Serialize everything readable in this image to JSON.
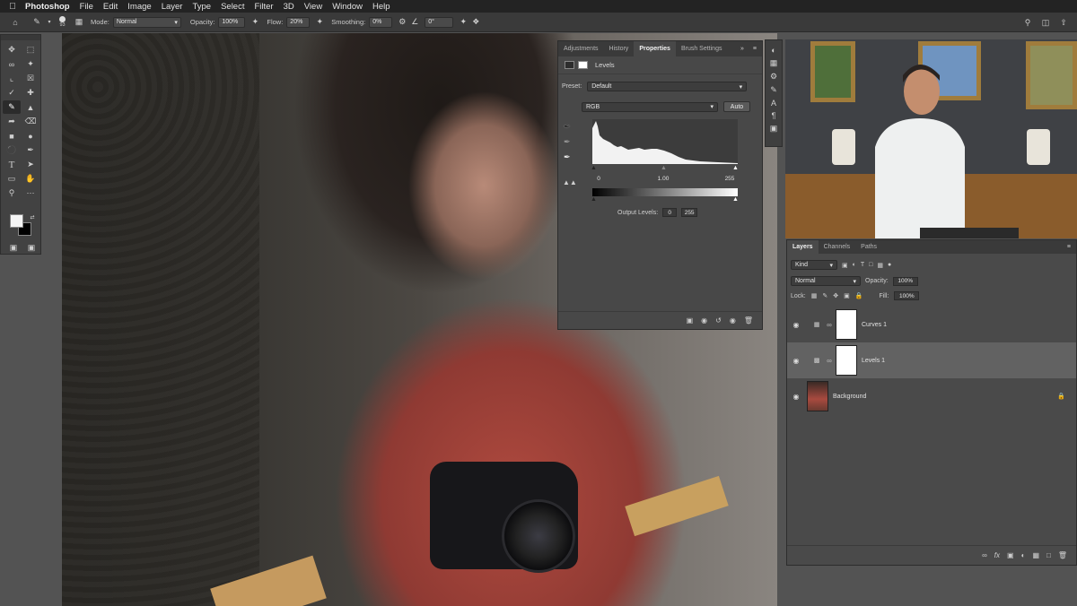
{
  "menubar": {
    "app_name": "Photoshop",
    "items": [
      "File",
      "Edit",
      "Image",
      "Layer",
      "Type",
      "Select",
      "Filter",
      "3D",
      "View",
      "Window",
      "Help"
    ]
  },
  "options_bar": {
    "brush_size": "93",
    "mode_label": "Mode:",
    "mode_value": "Normal",
    "opacity_label": "Opacity:",
    "opacity_value": "100%",
    "flow_label": "Flow:",
    "flow_value": "20%",
    "smoothing_label": "Smoothing:",
    "smoothing_value": "0%",
    "angle_value": "0°"
  },
  "properties": {
    "tabs": [
      "Adjustments",
      "History",
      "Properties",
      "Brush Settings"
    ],
    "active_tab": "Properties",
    "title": "Levels",
    "preset_label": "Preset:",
    "preset_value": "Default",
    "channel_value": "RGB",
    "auto_label": "Auto",
    "input_black": "0",
    "input_mid": "1.00",
    "input_white": "255",
    "output_label": "Output Levels:",
    "output_black": "0",
    "output_white": "255"
  },
  "layers": {
    "tabs": [
      "Layers",
      "Channels",
      "Paths"
    ],
    "active_tab": "Layers",
    "filter_value": "Kind",
    "blend_value": "Normal",
    "opacity_label": "Opacity:",
    "opacity_value": "100%",
    "lock_label": "Lock:",
    "fill_label": "Fill:",
    "fill_value": "100%",
    "items": [
      {
        "name": "Curves 1",
        "selected": false
      },
      {
        "name": "Levels 1",
        "selected": true
      },
      {
        "name": "Background",
        "selected": false
      }
    ]
  },
  "colors": {
    "accent_selected_layer": "#626262",
    "panel_bg": "#484848",
    "menubar_bg": "#232323"
  }
}
